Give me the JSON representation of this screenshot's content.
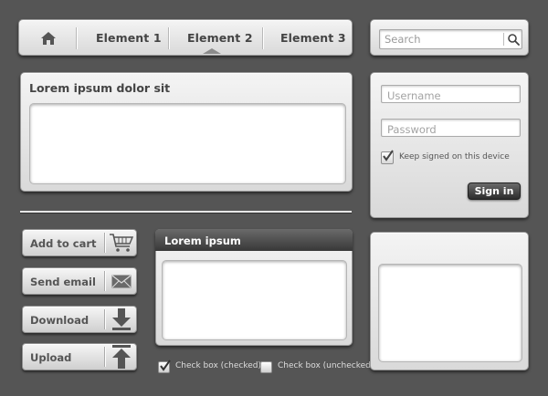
{
  "nav": {
    "items": [
      "Element 1",
      "Element 2",
      "Element 3"
    ],
    "active": "Element 2"
  },
  "search": {
    "placeholder": "Search"
  },
  "text_panel": {
    "title": "Lorem ipsum dolor sit"
  },
  "login": {
    "username_placeholder": "Username",
    "password_placeholder": "Password",
    "keep_signed_label": "Keep signed on this device",
    "keep_signed_checked": true,
    "signin_label": "Sign in"
  },
  "actions": [
    {
      "label": "Add to cart",
      "icon": "cart-icon"
    },
    {
      "label": "Send email",
      "icon": "envelope-icon"
    },
    {
      "label": "Download",
      "icon": "download-arrow-icon"
    },
    {
      "label": "Upload",
      "icon": "upload-arrow-icon"
    }
  ],
  "lorem_panel": {
    "title": "Lorem ipsum"
  },
  "checkboxes": [
    {
      "label": "Check box (checked)",
      "checked": true
    },
    {
      "label": "Check box (unchecked)",
      "checked": false
    }
  ],
  "colors": {
    "background": "#555555",
    "dark_button": "#3a3a3a",
    "panel": "#e6e6e6"
  }
}
